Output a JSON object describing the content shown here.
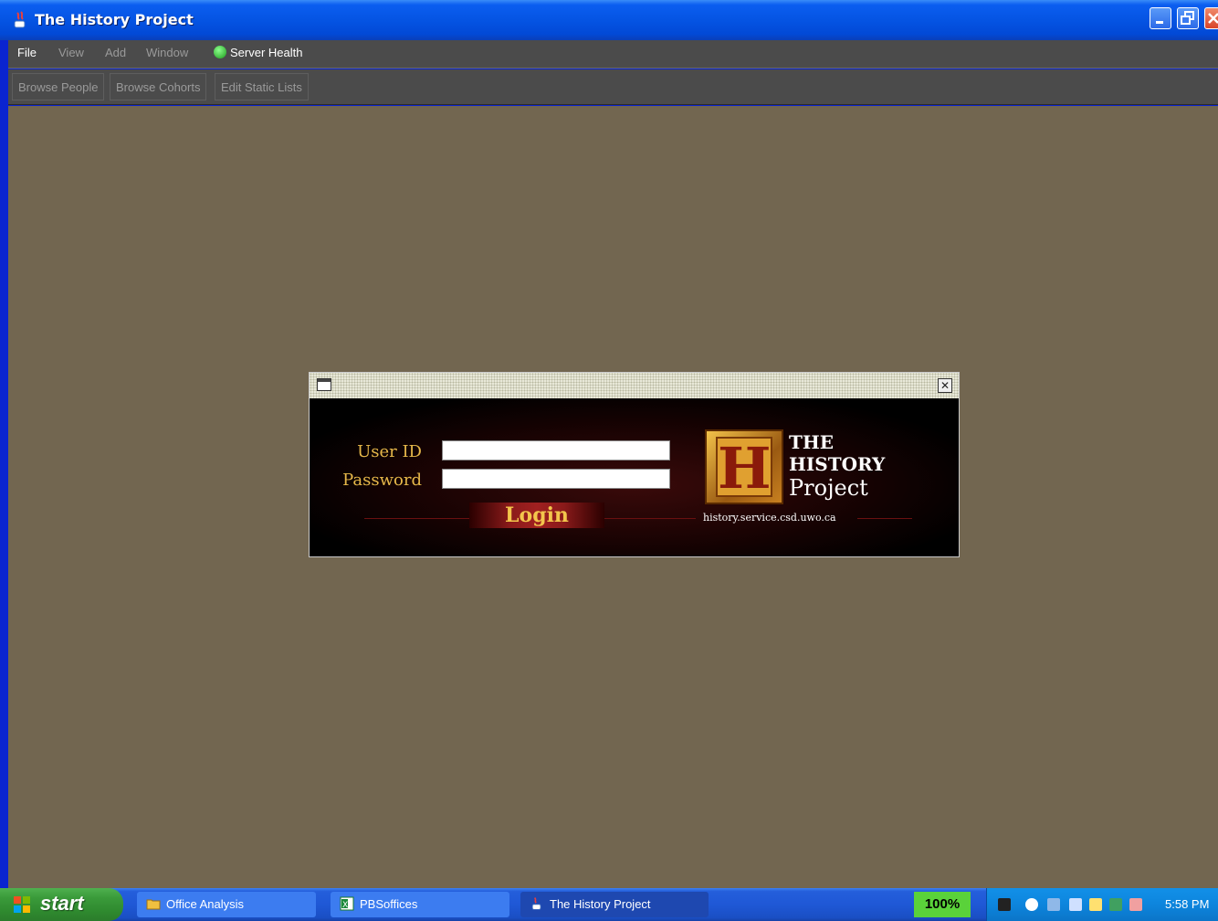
{
  "window": {
    "title": "The History Project"
  },
  "menubar": {
    "items": [
      {
        "label": "File",
        "enabled": true
      },
      {
        "label": "View",
        "enabled": false
      },
      {
        "label": "Add",
        "enabled": false
      },
      {
        "label": "Window",
        "enabled": false
      }
    ],
    "server_health": "Server Health"
  },
  "toolbar": {
    "buttons": [
      "Browse People",
      "Browse Cohorts",
      "Edit Static Lists"
    ]
  },
  "login": {
    "user_id_label": "User ID",
    "password_label": "Password",
    "user_id_value": "",
    "password_value": "",
    "login_button": "Login",
    "logo": {
      "line1": "THE",
      "line2": "HISTORY",
      "line3": "Project",
      "url": "history.service.csd.uwo.ca"
    }
  },
  "taskbar": {
    "start_label": "start",
    "tasks": [
      {
        "label": "Office Analysis",
        "icon": "folder-icon"
      },
      {
        "label": "PBSoffices",
        "icon": "excel-icon"
      },
      {
        "label": "The History Project",
        "icon": "java-icon",
        "active": true
      }
    ],
    "battery": "100%",
    "clock": "5:58 PM"
  },
  "colors": {
    "desktop": "#726650",
    "menubar": "#4b4b4b",
    "login_label": "#e6b84a",
    "titlebar": "#0554e3"
  }
}
